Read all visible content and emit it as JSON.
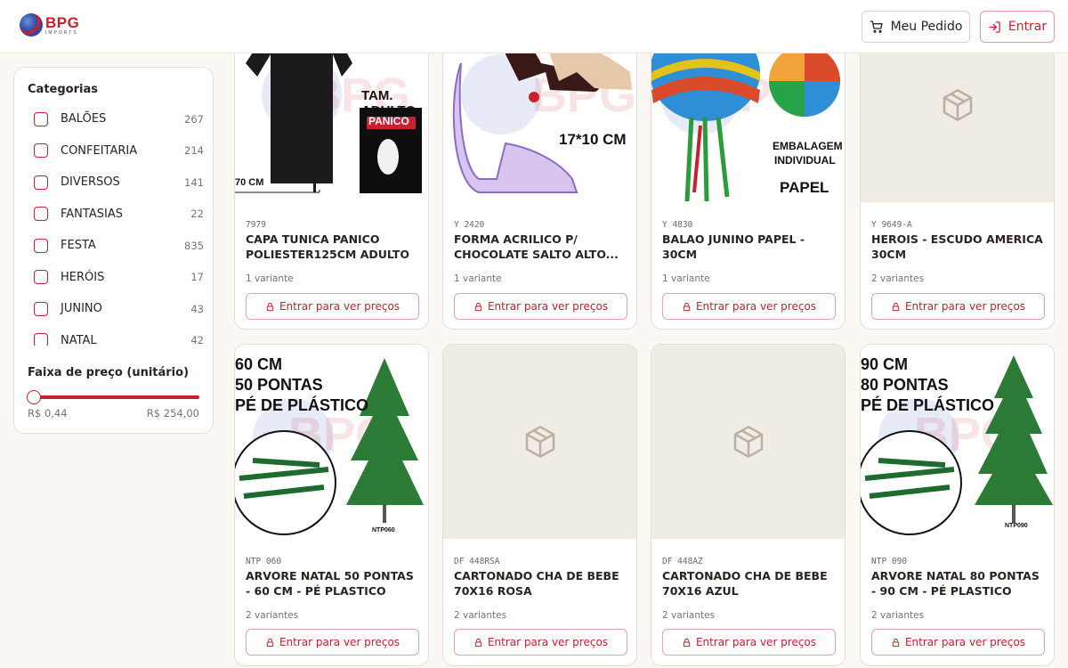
{
  "header": {
    "logo_name": "BPG",
    "logo_sub": "IMPORTS",
    "pedido_label": "Meu Pedido",
    "entrar_label": "Entrar"
  },
  "sidebar": {
    "categories_title": "Categorias",
    "categories": [
      {
        "label": "BALÕES",
        "count": "267"
      },
      {
        "label": "CONFEITARIA",
        "count": "214"
      },
      {
        "label": "DIVERSOS",
        "count": "141"
      },
      {
        "label": "FANTASIAS",
        "count": "22"
      },
      {
        "label": "FESTA",
        "count": "835"
      },
      {
        "label": "HERÓIS",
        "count": "17"
      },
      {
        "label": "JUNINO",
        "count": "43"
      },
      {
        "label": "NATAL",
        "count": "42"
      }
    ],
    "price_title": "Faixa de preço (unitário)",
    "price_min": "R$ 0,44",
    "price_max": "R$ 254,00",
    "price_selected_fraction": [
      0,
      1
    ]
  },
  "products": [
    {
      "code": "7979",
      "name": "CAPA TUNICA PANICO POLIESTER125CM ADULTO",
      "variants": "1 variante",
      "button": "Entrar para ver preços",
      "image_text": [
        "TAM. ADULTO",
        "PANICO",
        "70 CM"
      ]
    },
    {
      "code": "Y 2420",
      "name": "FORMA ACRILICO P/ CHOCOLATE SALTO ALTO...",
      "variants": "1 variante",
      "button": "Entrar para ver preços",
      "image_text": [
        "17*10 CM"
      ]
    },
    {
      "code": "Y 4830",
      "name": "BALAO JUNINO PAPEL - 30CM",
      "variants": "1 variante",
      "button": "Entrar para ver preços",
      "image_text": [
        "EMBALAGEM",
        "INDIVIDUAL",
        "PAPEL"
      ]
    },
    {
      "code": "Y 9649-A",
      "name": "HEROIS - ESCUDO AMERICA 30CM",
      "variants": "2 variantes",
      "button": "Entrar para ver preços",
      "image_text": []
    },
    {
      "code": "NTP 060",
      "name": "ARVORE NATAL 50 PONTAS - 60 CM - PÉ PLASTICO",
      "variants": "2 variantes",
      "button": "Entrar para ver preços",
      "image_text": [
        "60 CM",
        "50 PONTAS",
        "PÉ DE PLÁSTICO",
        "NTP060"
      ]
    },
    {
      "code": "DF 448RSA",
      "name": "CARTONADO CHA DE BEBE 70X16 ROSA",
      "variants": "2 variantes",
      "button": "Entrar para ver preços",
      "image_text": []
    },
    {
      "code": "DF 448AZ",
      "name": "CARTONADO CHA DE BEBE 70X16 AZUL",
      "variants": "2 variantes",
      "button": "Entrar para ver preços",
      "image_text": []
    },
    {
      "code": "NTP 090",
      "name": "ARVORE NATAL 80 PONTAS - 90 CM - PÉ PLASTICO",
      "variants": "2 variantes",
      "button": "Entrar para ver preços",
      "image_text": [
        "90 CM",
        "80 PONTAS",
        "PÉ DE PLÁSTICO",
        "NTP090"
      ]
    }
  ],
  "colors": {
    "accent": "#c8202c",
    "background": "#fbf8f4",
    "placeholder": "#f0ebe3"
  }
}
